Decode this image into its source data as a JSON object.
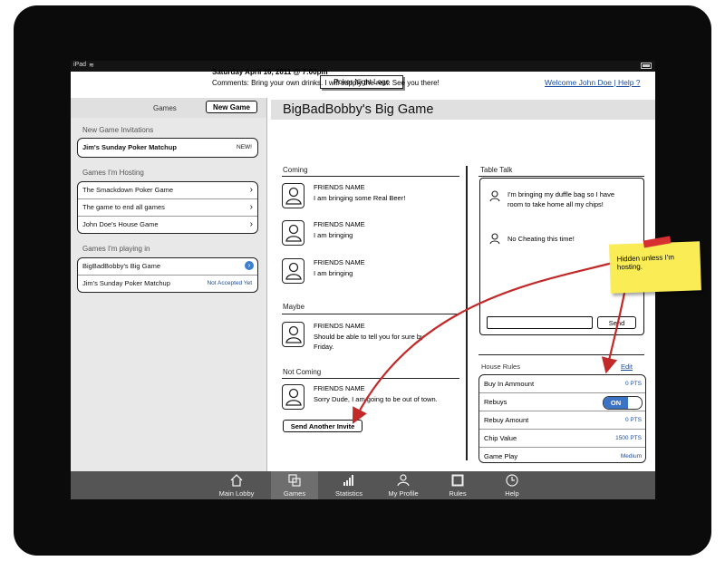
{
  "status": {
    "carrier": "iPad"
  },
  "header": {
    "logo": "Poker Night Logo",
    "welcome": "Welcome John Doe  |  Help  ?"
  },
  "sidebar": {
    "games_label": "Games",
    "new_game_label": "New Game",
    "invitations_title": "New Game Invitations",
    "invitations": [
      {
        "label": "Jim's Sunday Poker Matchup",
        "badge": "NEW!"
      }
    ],
    "hosting_title": "Games I'm Hosting",
    "hosting": [
      "The Smackdown Poker Game",
      "The game to end all games",
      "John Doe's House Game"
    ],
    "playing_title": "Games I'm playing in",
    "playing": [
      {
        "label": "BigBadBobby's Big Game",
        "status": ""
      },
      {
        "label": "Jim's Sunday Poker Matchup",
        "status": "Not Accepted Yet"
      }
    ]
  },
  "game": {
    "title": "BigBadBobby's Big Game",
    "date": "Saturday April 16, 2011 @ 7:00pm",
    "comments": "Comments: Bring your own drinks. I will supply the rest. See you there!"
  },
  "coming": {
    "title": "Coming",
    "people": [
      {
        "name": "FRIENDS NAME",
        "msg": "I am bringing some Real Beer!"
      },
      {
        "name": "FRIENDS NAME",
        "msg": "I am bringing"
      },
      {
        "name": "FRIENDS NAME",
        "msg": "I am bringing"
      }
    ]
  },
  "maybe": {
    "title": "Maybe",
    "people": [
      {
        "name": "FRIENDS NAME",
        "msg": "Should be able to tell you for sure by Friday."
      }
    ]
  },
  "not_coming": {
    "title": "Not Coming",
    "people": [
      {
        "name": "FRIENDS NAME",
        "msg": "Sorry Dude, I am going to be out of town."
      }
    ]
  },
  "send_invite_label": "Send Another Invite",
  "table_talk": {
    "title": "Table Talk",
    "messages": [
      "I'm bringing my duffle bag so I have room to take home all my chips!",
      "No Cheating this time!"
    ],
    "send_label": "Send"
  },
  "house_rules": {
    "title": "House Rules",
    "edit_label": "Edit",
    "rows": [
      {
        "label": "Buy In Ammount",
        "value": "0 PTS"
      },
      {
        "label": "Rebuys",
        "value": "ON"
      },
      {
        "label": "Rebuy Amount",
        "value": "0 PTS"
      },
      {
        "label": "Chip Value",
        "value": "1500 PTS"
      },
      {
        "label": "Game Play",
        "value": "Medium"
      }
    ]
  },
  "tabs": [
    {
      "label": "Main Lobby",
      "icon": "home-icon"
    },
    {
      "label": "Games",
      "icon": "games-icon"
    },
    {
      "label": "Statistics",
      "icon": "statistics-icon"
    },
    {
      "label": "My Profile",
      "icon": "profile-icon"
    },
    {
      "label": "Rules",
      "icon": "rules-icon"
    },
    {
      "label": "Help",
      "icon": "help-icon"
    }
  ],
  "sticky_note": "Hidden unless I'm hosting.",
  "colors": {
    "link": "#1b4da0",
    "toggle_on": "#3b74c6",
    "note": "#f9ec55",
    "arrow": "#c22a2a"
  }
}
